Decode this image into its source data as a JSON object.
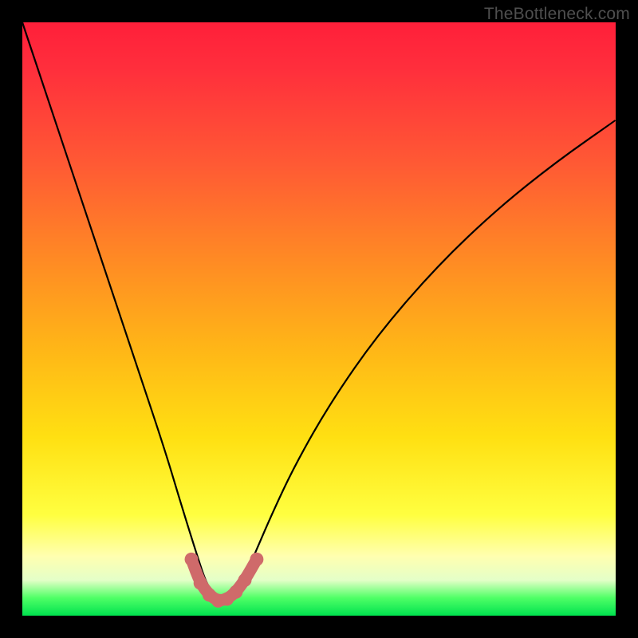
{
  "watermark": "TheBottleneck.com",
  "colors": {
    "frame": "#000000",
    "curve": "#000000",
    "trough": "#cf6a6a",
    "gradient_top": "#ff1f3a",
    "gradient_bottom": "#00e24f"
  },
  "chart_data": {
    "type": "line",
    "title": "",
    "xlabel": "",
    "ylabel": "",
    "xlim": [
      0,
      1
    ],
    "ylim": [
      0,
      1
    ],
    "note": "Axes are unlabeled; values given in normalized 0–1 units of the plot area (left→right, top→bottom). The curve is a V-shaped bottleneck profile falling steeply from top-left to a minimum near x≈0.33 then rising more gradually toward top-right.",
    "series": [
      {
        "name": "bottleneck-curve",
        "x": [
          0.0,
          0.04,
          0.08,
          0.12,
          0.16,
          0.2,
          0.24,
          0.27,
          0.295,
          0.31,
          0.325,
          0.34,
          0.355,
          0.37,
          0.39,
          0.42,
          0.46,
          0.52,
          0.6,
          0.7,
          0.8,
          0.9,
          1.0
        ],
        "y": [
          0.0,
          0.12,
          0.24,
          0.36,
          0.48,
          0.6,
          0.72,
          0.82,
          0.9,
          0.945,
          0.968,
          0.975,
          0.968,
          0.945,
          0.9,
          0.83,
          0.745,
          0.64,
          0.525,
          0.41,
          0.315,
          0.235,
          0.165
        ]
      }
    ],
    "trough_highlight": {
      "color": "#cf6a6a",
      "points_x": [
        0.285,
        0.3,
        0.315,
        0.33,
        0.345,
        0.36,
        0.375,
        0.395
      ],
      "points_y": [
        0.905,
        0.945,
        0.965,
        0.975,
        0.972,
        0.96,
        0.94,
        0.905
      ]
    }
  }
}
